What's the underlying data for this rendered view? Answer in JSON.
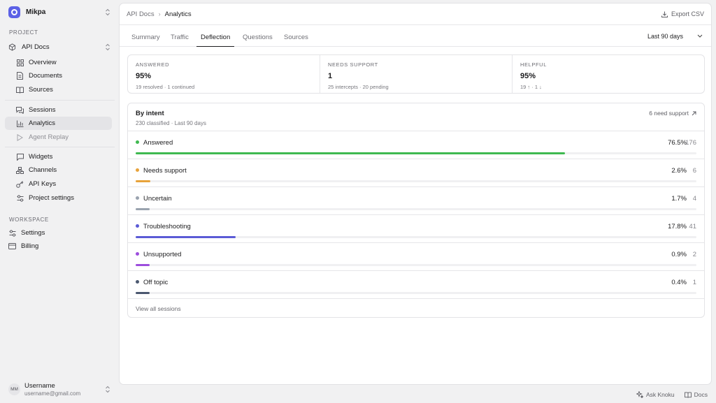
{
  "org": {
    "name": "Mikpa"
  },
  "sidebar": {
    "project_label": "PROJECT",
    "project_name": "API Docs",
    "items": [
      {
        "label": "Overview",
        "icon": "grid-icon"
      },
      {
        "label": "Documents",
        "icon": "document-icon"
      },
      {
        "label": "Sources",
        "icon": "book-icon"
      },
      {
        "label": "Sessions",
        "icon": "chat-icon"
      },
      {
        "label": "Analytics",
        "icon": "bar-chart-icon"
      },
      {
        "label": "Agent Replay",
        "icon": "play-icon"
      },
      {
        "label": "Widgets",
        "icon": "message-square-icon"
      },
      {
        "label": "Channels",
        "icon": "network-icon"
      },
      {
        "label": "API Keys",
        "icon": "key-icon"
      },
      {
        "label": "Project settings",
        "icon": "sliders-icon"
      }
    ],
    "workspace_label": "WORKSPACE",
    "workspace_items": [
      {
        "label": "Settings",
        "icon": "sliders-icon"
      },
      {
        "label": "Billing",
        "icon": "credit-card-icon"
      }
    ],
    "user": {
      "initials": "MM",
      "name": "Username",
      "email": "username@gmail.com"
    }
  },
  "breadcrumb": {
    "parent": "API Docs",
    "separator": "›",
    "current": "Analytics"
  },
  "export_label": "Export CSV",
  "tabs": [
    "Summary",
    "Traffic",
    "Deflection",
    "Questions",
    "Sources"
  ],
  "active_tab": "Deflection",
  "range": {
    "value": "Last 90 days"
  },
  "stats": [
    {
      "label": "ANSWERED",
      "value": "95%",
      "sub": "19 resolved · 1 continued"
    },
    {
      "label": "NEEDS SUPPORT",
      "value": "1",
      "sub": "25 intercepts · 20 pending"
    },
    {
      "label": "HELPFUL",
      "value": "95%",
      "sub": "19 ↑ · 1 ↓"
    }
  ],
  "intent": {
    "title": "By intent",
    "subtitle": "230 classified · Last 90 days",
    "link_label": "6 need support",
    "rows": [
      {
        "label": "Answered",
        "pct": "76.5%",
        "count": "176",
        "fraction": 0.765,
        "color": "#3fb950"
      },
      {
        "label": "Needs support",
        "pct": "2.6%",
        "count": "6",
        "fraction": 0.026,
        "color": "#e8a33b"
      },
      {
        "label": "Uncertain",
        "pct": "1.7%",
        "count": "4",
        "fraction": 0.017,
        "color": "#9aa3af"
      },
      {
        "label": "Troubleshooting",
        "pct": "17.8%",
        "count": "41",
        "fraction": 0.178,
        "color": "#5b5bd6"
      },
      {
        "label": "Unsupported",
        "pct": "0.9%",
        "count": "2",
        "fraction": 0.009,
        "color": "#9d4edd"
      },
      {
        "label": "Off topic",
        "pct": "0.4%",
        "count": "1",
        "fraction": 0.004,
        "color": "#4b5870"
      }
    ],
    "view_all": "View all sessions"
  },
  "footer": {
    "ask": "Ask Knoku",
    "docs": "Docs"
  }
}
